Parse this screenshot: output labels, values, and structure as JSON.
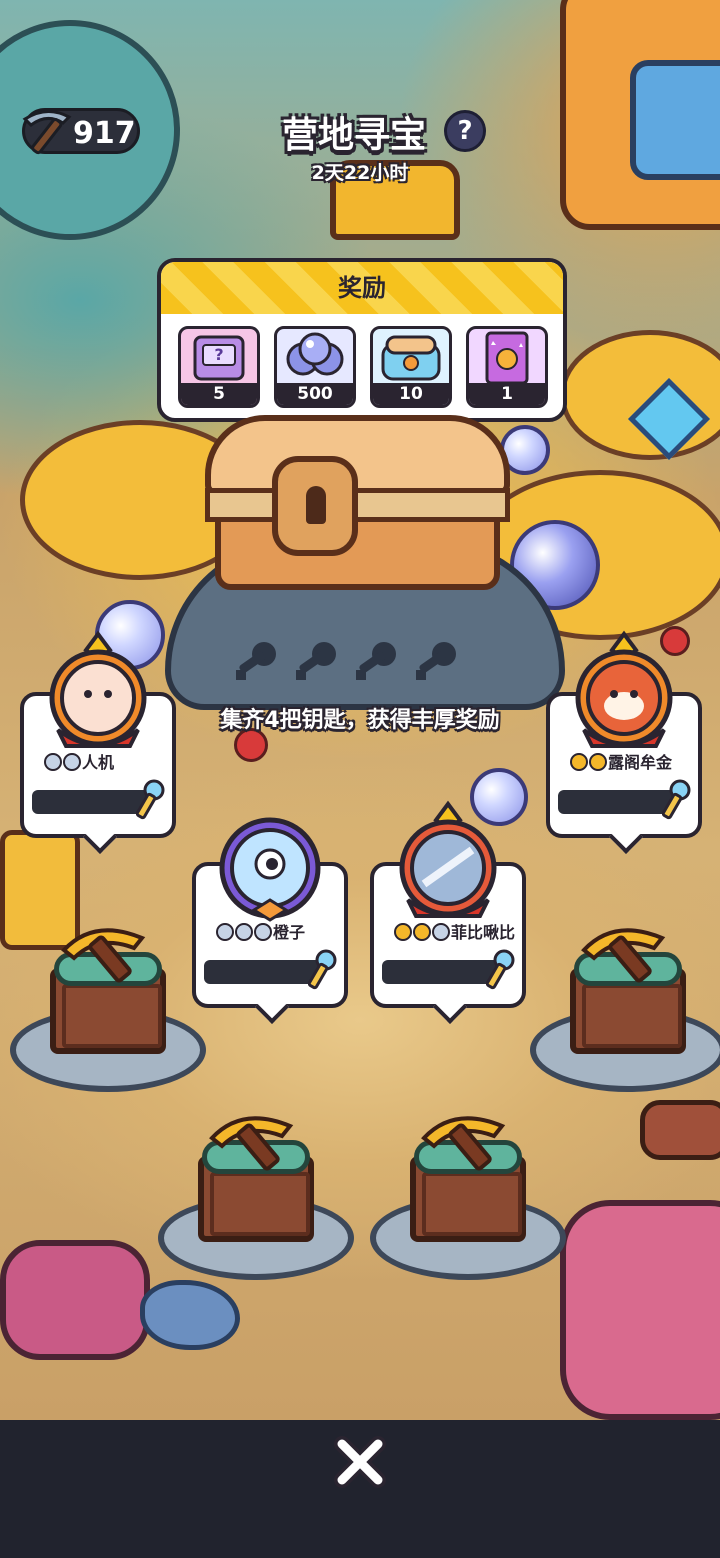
{
  "header": {
    "pickaxe_count": "917",
    "title": "营地寻宝",
    "help_label": "?",
    "timer": "2天22小时"
  },
  "rewards": {
    "title": "奖励",
    "items": [
      {
        "icon": "mystery-box-icon",
        "quantity": "5",
        "color": "#b88ce6"
      },
      {
        "icon": "blue-orbs-icon",
        "quantity": "500",
        "color": "#8c93e8"
      },
      {
        "icon": "lunchbox-icon",
        "quantity": "10",
        "color": "#7fd0f0"
      },
      {
        "icon": "sticker-pack-icon",
        "quantity": "1",
        "color": "#c66ae0"
      }
    ]
  },
  "chest": {
    "key_slots": 4,
    "keys_collected": 0,
    "hint": "集齐4把钥匙，获得丰厚奖励"
  },
  "players": [
    {
      "name": "人机",
      "avatar": "rabbit-avatar",
      "medals": [
        "silver",
        "silver"
      ],
      "frame_color": "#f08a2a"
    },
    {
      "name": "橙子",
      "avatar": "cyclops-avatar",
      "medals": [
        "silver",
        "silver",
        "silver"
      ],
      "frame_color": "#7b5ad6"
    },
    {
      "name": "菲比啾比",
      "avatar": "unicorn-avatar",
      "medals": [
        "gold",
        "gold",
        "silver"
      ],
      "frame_color": "#e55a3a"
    },
    {
      "name": "露阁牟金",
      "avatar": "red-panda-avatar",
      "medals": [
        "gold",
        "gold"
      ],
      "frame_color": "#f08a2a"
    }
  ],
  "dig_sites": 5,
  "footer": {
    "close_icon": "close-icon"
  }
}
